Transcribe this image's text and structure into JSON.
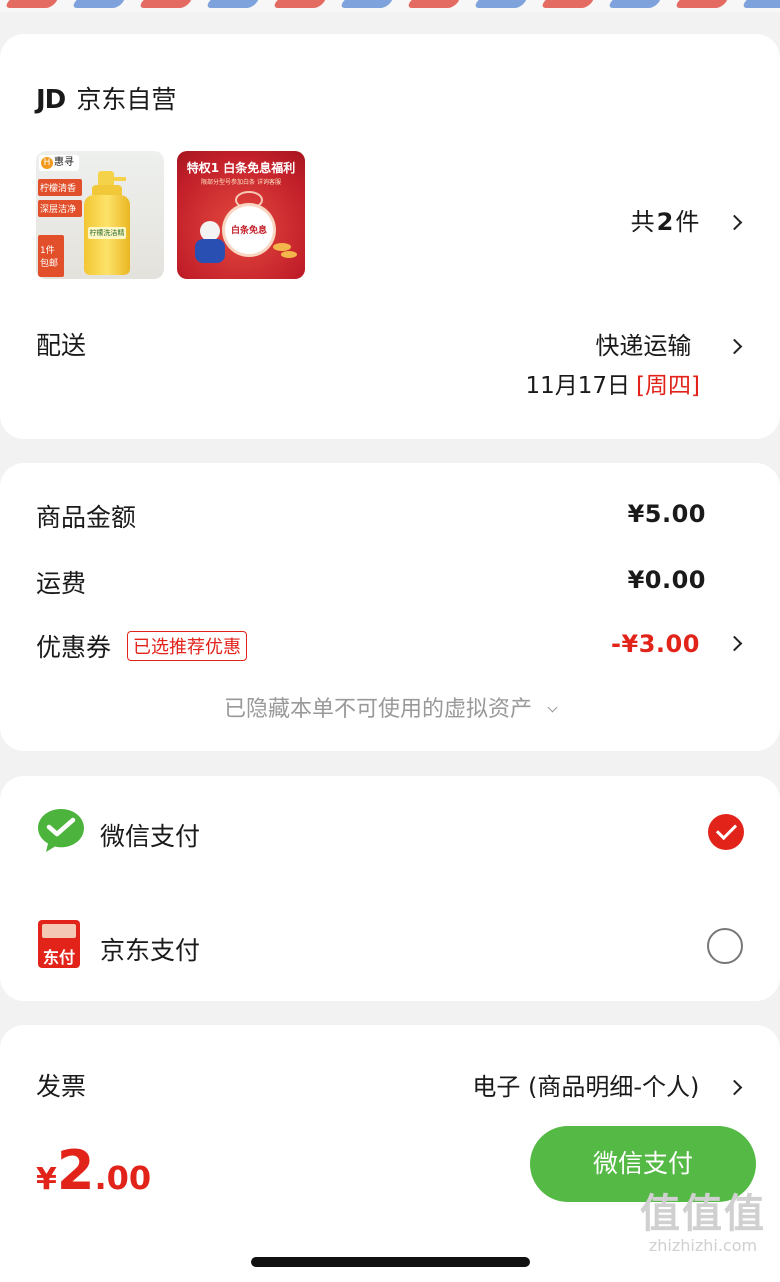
{
  "store": {
    "logo": "JD",
    "name": "京东自营"
  },
  "items": {
    "count_prefix": "共",
    "count": "2",
    "count_suffix": "件",
    "product1": {
      "brand": "惠寻",
      "tag1": "柠檬清香",
      "tag2": "深层洁净",
      "tag3": "1件包邮",
      "bottle_label": "柠檬洗洁精"
    },
    "product2": {
      "title": "特权1 白条免息福利",
      "subtitle": "限部分型号参加白条 详询客服",
      "badge": "白条免息"
    }
  },
  "delivery": {
    "label": "配送",
    "method": "快递运输",
    "date": "11月17日",
    "weekday": "[周四]"
  },
  "summary": {
    "goods_label": "商品金额",
    "goods_value": "¥5.00",
    "shipping_label": "运费",
    "shipping_value": "¥0.00",
    "coupon_label": "优惠券",
    "coupon_tag": "已选推荐优惠",
    "coupon_value": "-¥3.00",
    "hidden_assets": "已隐藏本单不可使用的虚拟资产"
  },
  "payment": {
    "wechat_label": "微信支付",
    "jd_label": "京东支付",
    "jd_icon_text": "东付",
    "selected": "wechat"
  },
  "invoice": {
    "label": "发票",
    "value": "电子 (商品明细-个人)"
  },
  "footer": {
    "currency": "¥",
    "total_int": "2",
    "total_dec": ".00",
    "pay_button": "微信支付"
  },
  "watermark": {
    "cn": "值值值",
    "url": "zhizhizhi.com"
  },
  "colors": {
    "accent_red": "#e2231a",
    "wechat_green": "#4cb43c",
    "pay_button": "#55b945"
  }
}
